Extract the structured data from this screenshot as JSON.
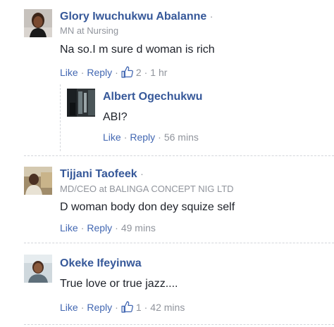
{
  "comments": [
    {
      "author": "Glory Iwuchukwu Abalanne",
      "subtitle": "MN at Nursing",
      "text": "Na so.I m sure d woman is rich",
      "like_label": "Like",
      "reply_label": "Reply",
      "likes": "2",
      "time": "1 hr",
      "replies": [
        {
          "author": "Albert Ogechukwu",
          "text": "ABI?",
          "like_label": "Like",
          "reply_label": "Reply",
          "time": "56 mins"
        }
      ]
    },
    {
      "author": "Tijjani Taofeek",
      "subtitle": "MD/CEO at BALINGA CONCEPT NIG LTD",
      "text": "D woman body don dey squize self",
      "like_label": "Like",
      "reply_label": "Reply",
      "time": "49 mins"
    },
    {
      "author": "Okeke Ifeyinwa",
      "text": "True love or true jazz....",
      "like_label": "Like",
      "reply_label": "Reply",
      "likes": "1",
      "time": "42 mins"
    }
  ],
  "separator_dot": "·",
  "icons": {
    "like_reaction": "thumbs-up-icon"
  },
  "colors": {
    "author": "#365899",
    "link": "#4267b2",
    "muted": "#90949c",
    "like_badge": "#4267b2"
  }
}
